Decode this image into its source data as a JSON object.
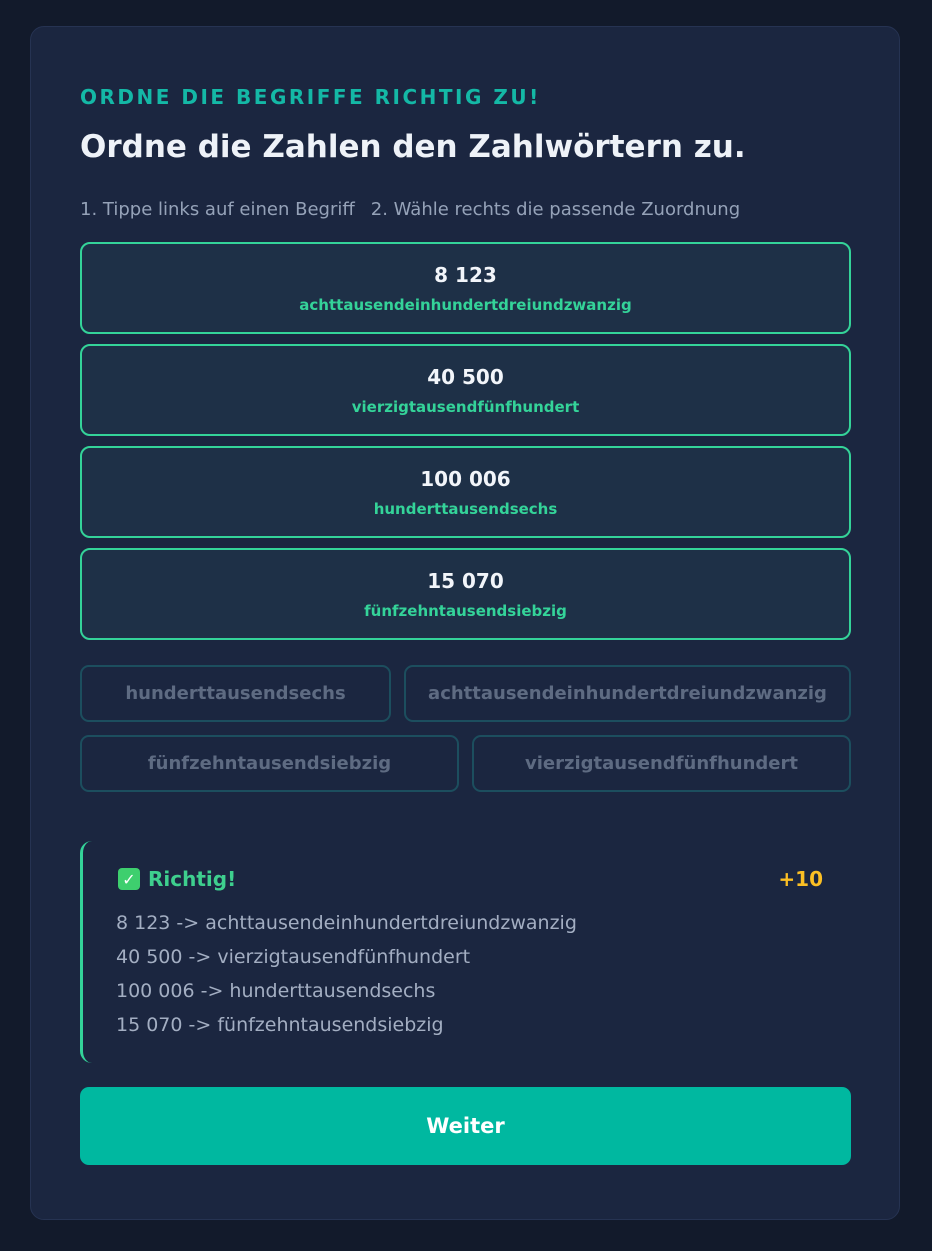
{
  "kicker": "ORDNE DIE BEGRIFFE RICHTIG ZU!",
  "title": "Ordne die Zahlen den Zahlwörtern zu.",
  "instructions": {
    "step1": "1. Tippe links auf einen Begriff",
    "step2": "2. Wähle rechts die passende Zuordnung"
  },
  "pairs": [
    {
      "number": "8 123",
      "word": "achttausendeinhundertdreiundzwanzig"
    },
    {
      "number": "40 500",
      "word": "vierzigtausendfünfhundert"
    },
    {
      "number": "100 006",
      "word": "hunderttausendsechs"
    },
    {
      "number": "15 070",
      "word": "fünfzehntausendsiebzig"
    }
  ],
  "options": [
    "hunderttausendsechs",
    "achttausendeinhundertdreiundzwanzig",
    "fünfzehntausendsiebzig",
    "vierzigtausendfünfhundert"
  ],
  "feedback": {
    "icon": "check-mark-icon",
    "title": "Richtig!",
    "points": "+10",
    "lines": [
      "8 123 -> achttausendeinhundertdreiundzwanzig",
      "40 500 -> vierzigtausendfünfhundert",
      "100 006 -> hunderttausendsechs",
      "15 070 -> fünfzehntausendsiebzig"
    ]
  },
  "next_button": "Weiter",
  "colors": {
    "accent": "#14b8a6",
    "correct": "#34d399",
    "points": "#fbbf24",
    "button": "#00b8a0"
  }
}
